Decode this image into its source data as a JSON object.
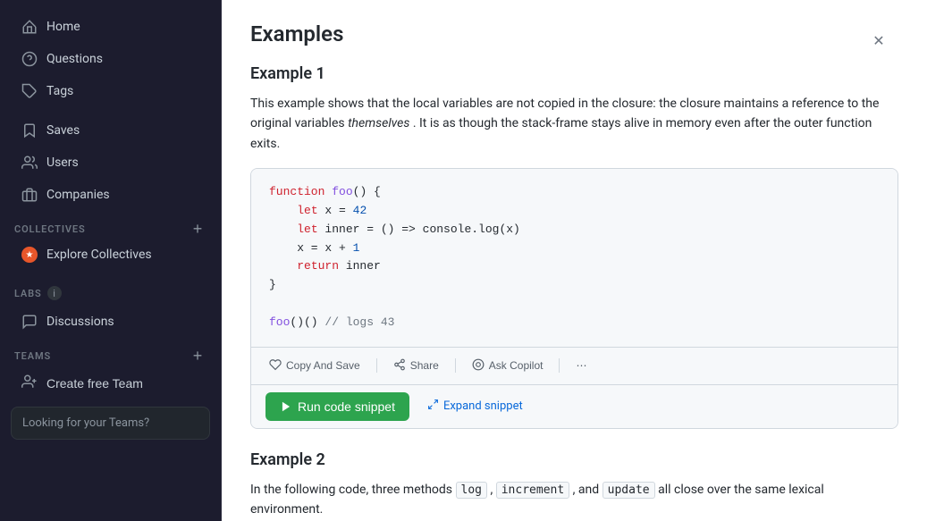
{
  "sidebar": {
    "nav_items": [
      {
        "id": "home",
        "label": "Home",
        "icon": "🏠"
      },
      {
        "id": "questions",
        "label": "Questions",
        "icon": "❓"
      },
      {
        "id": "tags",
        "label": "Tags",
        "icon": "🏷"
      }
    ],
    "saves_label": "Saves",
    "users_label": "Users",
    "companies_label": "Companies",
    "collectives_section_label": "Collectives",
    "add_collective_tooltip": "+",
    "explore_collectives_label": "Explore Collectives",
    "labs_section_label": "Labs",
    "discussions_label": "Discussions",
    "teams_section_label": "Teams",
    "add_teams_tooltip": "+",
    "create_free_team_label": "Create free Team",
    "looking_for_teams_label": "Looking for your Teams?"
  },
  "main": {
    "page_title": "Examples",
    "example1": {
      "title": "Example 1",
      "description_part1": "This example shows that the local variables are not copied in the closure: the closure maintains a reference to the original variables",
      "description_italic": "themselves",
      "description_part2": ". It is as though the stack-frame stays alive in memory even after the outer function exits.",
      "code_lines": [
        {
          "tokens": [
            {
              "type": "kw",
              "text": "function"
            },
            {
              "type": "plain",
              "text": " "
            },
            {
              "type": "fn",
              "text": "foo"
            },
            {
              "type": "plain",
              "text": "() {"
            }
          ]
        },
        {
          "tokens": [
            {
              "type": "plain",
              "text": "    "
            },
            {
              "type": "kw",
              "text": "let"
            },
            {
              "type": "plain",
              "text": " x = "
            },
            {
              "type": "num",
              "text": "42"
            }
          ]
        },
        {
          "tokens": [
            {
              "type": "plain",
              "text": "    "
            },
            {
              "type": "kw",
              "text": "let"
            },
            {
              "type": "plain",
              "text": " inner = () => console.log(x)"
            }
          ]
        },
        {
          "tokens": [
            {
              "type": "plain",
              "text": "    x = x + "
            },
            {
              "type": "num",
              "text": "1"
            }
          ]
        },
        {
          "tokens": [
            {
              "type": "plain",
              "text": "    "
            },
            {
              "type": "kw",
              "text": "return"
            },
            {
              "type": "plain",
              "text": " inner"
            }
          ]
        },
        {
          "tokens": [
            {
              "type": "plain",
              "text": "}"
            }
          ]
        },
        {
          "tokens": []
        },
        {
          "tokens": [
            {
              "type": "fn",
              "text": "foo"
            },
            {
              "type": "plain",
              "text": "()() // logs "
            },
            {
              "type": "num",
              "text": "43"
            }
          ]
        }
      ],
      "toolbar": {
        "copy_save_label": "Copy And Save",
        "share_label": "Share",
        "ask_copilot_label": "Ask Copilot"
      },
      "run_snippet_label": "Run code snippet",
      "expand_snippet_label": "Expand snippet"
    },
    "example2": {
      "title": "Example 2",
      "description_part1": "In the following code, three methods",
      "log_code": "log",
      "comma1": ",",
      "increment_code": "increment",
      "comma2": ", and",
      "update_code": "update",
      "description_part2": "all close over the same lexical environment."
    }
  },
  "icons": {
    "home": "⌂",
    "questions": "?",
    "tags": "◈",
    "saves": "🔖",
    "users": "👥",
    "companies": "🏢",
    "copy": "📋",
    "share": "↗",
    "copilot": "◎",
    "more": "⋯",
    "play": "▶",
    "expand": "⤢",
    "plus": "+",
    "info": "i",
    "chat": "💬",
    "team": "👥",
    "close": "✕"
  }
}
